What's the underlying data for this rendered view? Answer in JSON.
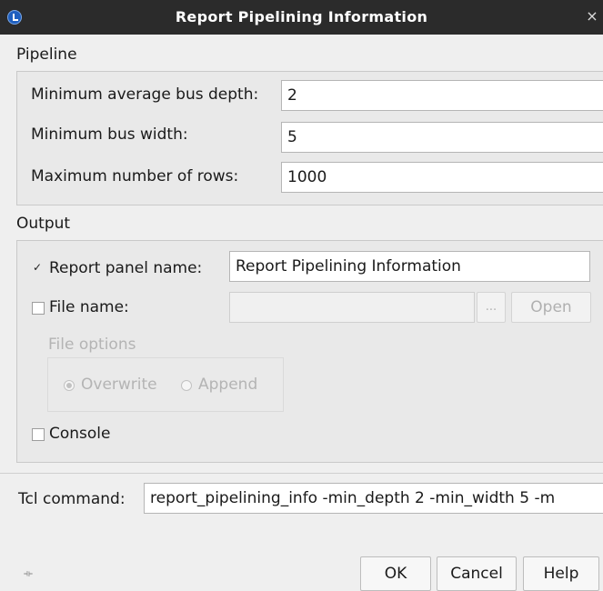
{
  "window": {
    "title": "Report Pipelining Information",
    "close_glyph": "×"
  },
  "pipeline": {
    "section_label": "Pipeline",
    "min_avg_bus_depth_label": "Minimum average bus depth:",
    "min_avg_bus_depth_value": "2",
    "min_bus_width_label": "Minimum bus width:",
    "min_bus_width_value": "5",
    "max_rows_label": "Maximum number of rows:",
    "max_rows_value": "1000"
  },
  "output": {
    "section_label": "Output",
    "report_panel_checked": true,
    "report_panel_check_glyph": "✓",
    "report_panel_label": "Report panel name:",
    "report_panel_value": "Report Pipelining Information",
    "file_name_checked": false,
    "file_name_label": "File name:",
    "file_name_value": "",
    "browse_label": "...",
    "open_label": "Open",
    "file_options_label": "File options",
    "overwrite_label": "Overwrite",
    "overwrite_selected": true,
    "append_label": "Append",
    "console_checked": false,
    "console_label": "Console"
  },
  "tcl": {
    "label": "Tcl command:",
    "value": "report_pipelining_info -min_depth 2 -min_width 5 -m"
  },
  "footer": {
    "grip_glyph": "⟛",
    "ok_label": "OK",
    "cancel_label": "Cancel",
    "help_label": "Help"
  },
  "colors": {
    "title_bar": "#2b2b2b",
    "dialog_background": "#efefef",
    "group_background": "#e9e9e9",
    "disabled_text": "#b4b4b4"
  }
}
